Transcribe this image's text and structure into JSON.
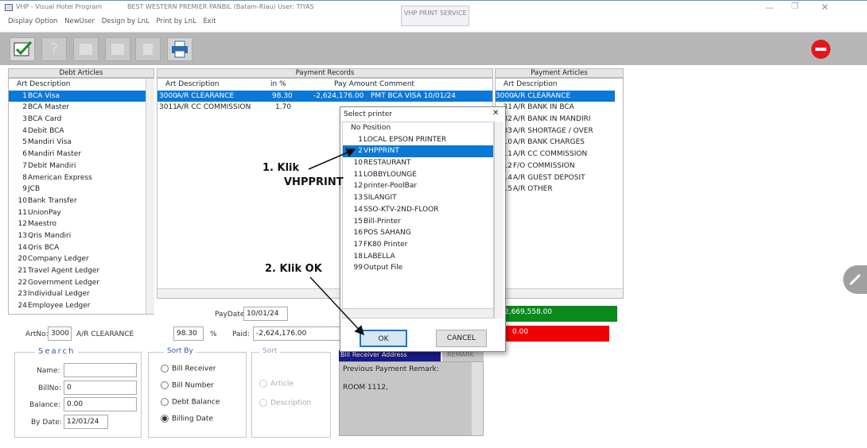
{
  "titlebar": {
    "app_title": "VHP - Visual Hotel Program",
    "hotel": "BEST WESTERN PREMIER PANBIL (Batam-Riau) User: TIYAS",
    "tab": "VHP PRINT SERVICE"
  },
  "menu": [
    "Display Option",
    "NewUser",
    "Design by LnL",
    "Print by LnL",
    "Exit"
  ],
  "debt_articles": {
    "header": "Debt Articles",
    "col_header": "Art Description",
    "rows": [
      {
        "no": "1",
        "desc": "BCA Visa"
      },
      {
        "no": "2",
        "desc": "BCA Master"
      },
      {
        "no": "3",
        "desc": "BCA Card"
      },
      {
        "no": "4",
        "desc": "Debit BCA"
      },
      {
        "no": "5",
        "desc": "Mandiri Visa"
      },
      {
        "no": "6",
        "desc": "Mandiri Master"
      },
      {
        "no": "7",
        "desc": "Debit Mandiri"
      },
      {
        "no": "8",
        "desc": "American Express"
      },
      {
        "no": "9",
        "desc": "JCB"
      },
      {
        "no": "10",
        "desc": "Bank Transfer"
      },
      {
        "no": "11",
        "desc": "UnionPay"
      },
      {
        "no": "12",
        "desc": "Maestro"
      },
      {
        "no": "13",
        "desc": "Qris Mandiri"
      },
      {
        "no": "14",
        "desc": "Qris BCA"
      },
      {
        "no": "20",
        "desc": "Company Ledger"
      },
      {
        "no": "21",
        "desc": "Travel Agent Ledger"
      },
      {
        "no": "22",
        "desc": "Government Ledger"
      },
      {
        "no": "23",
        "desc": "Individual Ledger"
      },
      {
        "no": "24",
        "desc": "Employee Ledger"
      }
    ]
  },
  "payment_records": {
    "header": "Payment Records",
    "cols": [
      "Art Description",
      "in %",
      "Pay Amount Comment"
    ],
    "rows": [
      {
        "art": "3000",
        "desc": "A/R CLEARANCE",
        "pct": "98.30",
        "amount": "-2,624,176.00",
        "comment": "PMT BCA VISA 10/01/24"
      },
      {
        "art": "3011",
        "desc": "A/R CC COMMISSION",
        "pct": "1.70",
        "amount": "",
        "comment": ""
      }
    ]
  },
  "payment_articles": {
    "header": "Payment Articles",
    "col_header": "Art Description",
    "rows": [
      {
        "no": "3000",
        "desc": "A/R CLEARANCE"
      },
      {
        "no": "31",
        "desc": "A/R BANK IN BCA"
      },
      {
        "no": "32",
        "desc": "A/R BANK IN MANDIRI"
      },
      {
        "no": "33",
        "desc": "A/R SHORTAGE / OVER"
      },
      {
        "no": "10",
        "desc": "A/R BANK CHARGES"
      },
      {
        "no": "11",
        "desc": "A/R CC COMMISSION"
      },
      {
        "no": "12",
        "desc": "F/O COMMISSION"
      },
      {
        "no": "14",
        "desc": "A/R GUEST DEPOSIT"
      },
      {
        "no": "15",
        "desc": "A/R OTHER"
      }
    ]
  },
  "form": {
    "paydate_label": "PayDate:",
    "paydate": "10/01/24",
    "artno_label": "ArtNo:",
    "artno": "3000",
    "art_desc": "A/R CLEARANCE",
    "pct": "98.30",
    "pct_unit": "%",
    "paid_label": "Paid:",
    "paid": "-2,624,176.00",
    "green_amount": "2,669,558.00",
    "red_amount": "0.00"
  },
  "search": {
    "title": "Search",
    "name_label": "Name:",
    "name": "",
    "billno_label": "BillNo:",
    "billno": "0",
    "balance_label": "Balance:",
    "balance": "0.00",
    "bydate_label": "By Date:",
    "bydate": "12/01/24"
  },
  "sortby": {
    "title": "Sort By",
    "options": [
      "Bill Receiver",
      "Bill Number",
      "Debt Balance",
      "Billing Date"
    ],
    "selected": 3
  },
  "sort": {
    "title": "Sort",
    "options": [
      "Article",
      "Description"
    ]
  },
  "bill_receiver": {
    "header": "Bill Receiver Address",
    "remark_tab": "REMARK",
    "remark_label": "Previous Payment Remark:",
    "remark": "ROOM 1112,"
  },
  "dialog": {
    "title": "Select printer",
    "col": "No Position",
    "rows": [
      {
        "no": "1",
        "name": "LOCAL EPSON PRINTER"
      },
      {
        "no": "2",
        "name": "VHPPRINT"
      },
      {
        "no": "10",
        "name": "RESTAURANT"
      },
      {
        "no": "11",
        "name": "LOBBYLOUNGE"
      },
      {
        "no": "12",
        "name": "printer-PoolBar"
      },
      {
        "no": "13",
        "name": "SILANGIT"
      },
      {
        "no": "14",
        "name": "SSO-KTV-2ND-FLOOR"
      },
      {
        "no": "15",
        "name": "Bill-Printer"
      },
      {
        "no": "16",
        "name": "POS SAHANG"
      },
      {
        "no": "17",
        "name": "FK80 Printer"
      },
      {
        "no": "18",
        "name": "LABELLA"
      },
      {
        "no": "99",
        "name": "Output File"
      }
    ],
    "ok": "OK",
    "cancel": "CANCEL",
    "close": "✕"
  },
  "annotations": {
    "step1_a": "1.  Klik",
    "step1_b": "VHPPRINT",
    "step2": "2.  Klik OK"
  },
  "colors": {
    "selection": "#0a78d7",
    "green": "#0a8a1a",
    "red": "#f10000"
  }
}
